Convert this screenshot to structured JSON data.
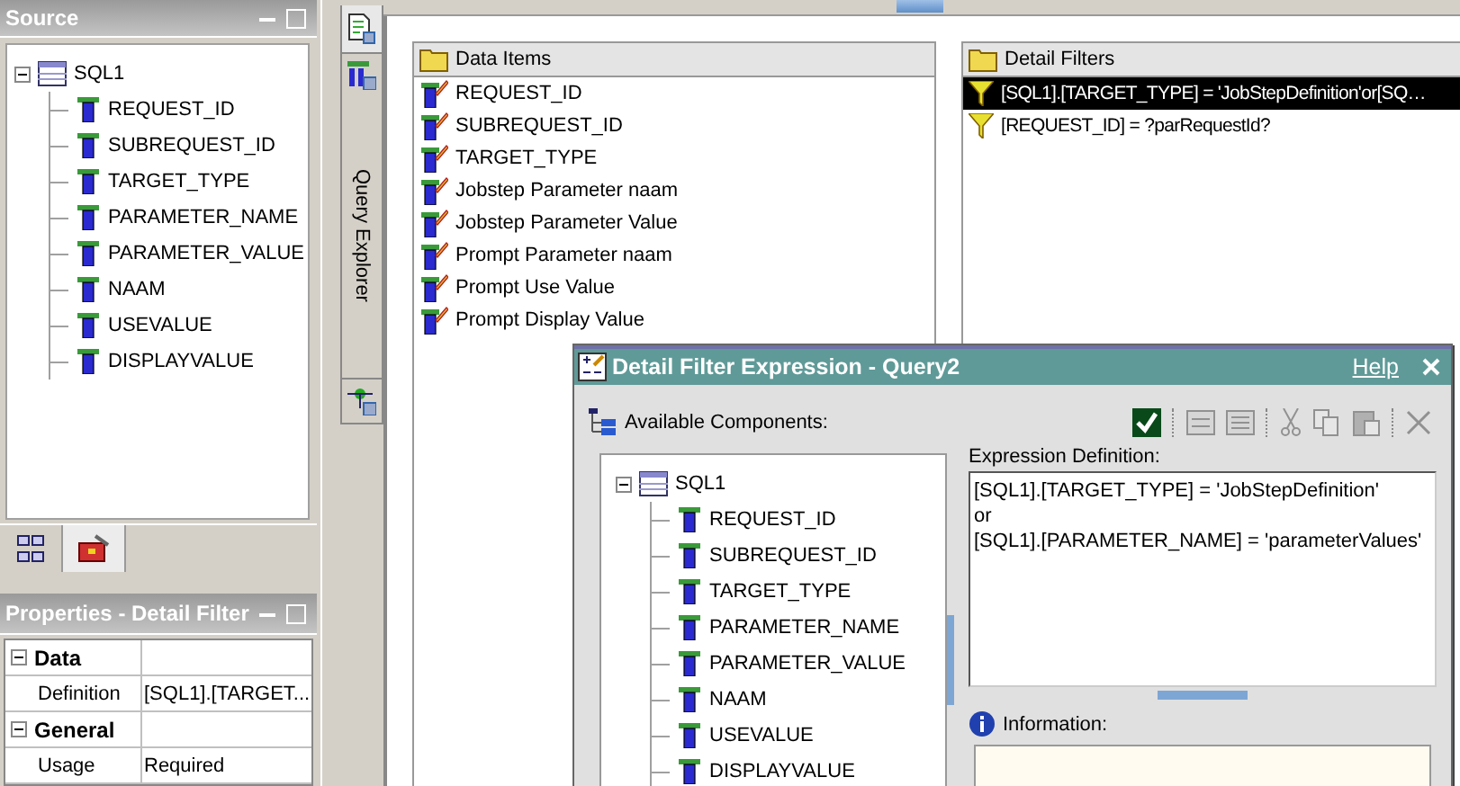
{
  "source_panel": {
    "title": "Source",
    "tree": {
      "label": "SQL1",
      "expanded": true,
      "children": [
        {
          "label": "REQUEST_ID"
        },
        {
          "label": "SUBREQUEST_ID"
        },
        {
          "label": "TARGET_TYPE"
        },
        {
          "label": "PARAMETER_NAME"
        },
        {
          "label": "PARAMETER_VALUE"
        },
        {
          "label": "NAAM"
        },
        {
          "label": "USEVALUE"
        },
        {
          "label": "DISPLAYVALUE"
        }
      ]
    }
  },
  "source_tabs": [
    {
      "kind": "structure",
      "selected": false
    },
    {
      "kind": "toolbox",
      "selected": true
    }
  ],
  "properties_panel": {
    "title": "Properties -  Detail Filter",
    "groups": [
      {
        "label": "Data",
        "expanded": true,
        "rows": [
          {
            "name": "Definition",
            "value": "[SQL1].[TARGET..."
          }
        ]
      },
      {
        "label": "General",
        "expanded": true,
        "rows": [
          {
            "name": "Usage",
            "value": "Required"
          }
        ]
      }
    ]
  },
  "side_tabs": [
    {
      "kind": "page",
      "selected": true
    },
    {
      "kind": "query",
      "label": "Query Explorer",
      "selected": false
    },
    {
      "kind": "flow",
      "selected": false
    }
  ],
  "data_items": {
    "title": "Data Items",
    "items": [
      "REQUEST_ID",
      "SUBREQUEST_ID",
      "TARGET_TYPE",
      "Jobstep Parameter naam",
      "Jobstep Parameter Value",
      "Prompt Parameter naam",
      "Prompt Use Value",
      "Prompt Display Value"
    ]
  },
  "detail_filters": {
    "title": "Detail Filters",
    "items": [
      {
        "text": "[SQL1].[TARGET_TYPE] = 'JobStepDefinition'or[SQ…",
        "selected": true
      },
      {
        "text": "[REQUEST_ID] = ?parRequestId?",
        "selected": false
      }
    ]
  },
  "dialog": {
    "title": "Detail Filter Expression - Query2",
    "help": "Help",
    "available_label": "Available Components:",
    "toolbar": [
      {
        "kind": "check",
        "disabled": false
      },
      {
        "kind": "sep"
      },
      {
        "kind": "rows1",
        "disabled": true
      },
      {
        "kind": "rows2",
        "disabled": true
      },
      {
        "kind": "sep"
      },
      {
        "kind": "cut",
        "disabled": true
      },
      {
        "kind": "copy",
        "disabled": true
      },
      {
        "kind": "paste",
        "disabled": true
      },
      {
        "kind": "sep"
      },
      {
        "kind": "delete",
        "disabled": true
      }
    ],
    "tree": {
      "label": "SQL1",
      "expanded": true,
      "children": [
        {
          "label": "REQUEST_ID"
        },
        {
          "label": "SUBREQUEST_ID"
        },
        {
          "label": "TARGET_TYPE"
        },
        {
          "label": "PARAMETER_NAME"
        },
        {
          "label": "PARAMETER_VALUE"
        },
        {
          "label": "NAAM"
        },
        {
          "label": "USEVALUE"
        },
        {
          "label": "DISPLAYVALUE"
        }
      ]
    },
    "expression_label": "Expression Definition:",
    "expression_lines": [
      "[SQL1].[TARGET_TYPE] = 'JobStepDefinition'",
      "or",
      "[SQL1].[PARAMETER_NAME] = 'parameterValues'"
    ],
    "information_label": "Information:"
  }
}
